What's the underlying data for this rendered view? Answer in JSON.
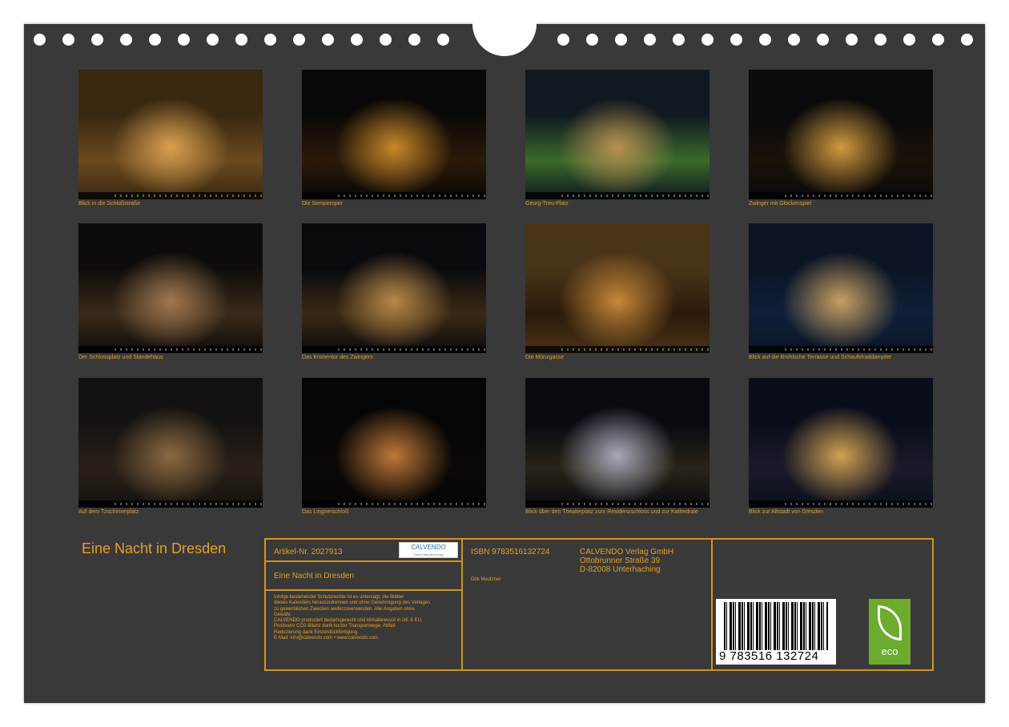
{
  "photos": [
    {
      "caption": "Blick in die Schloßstraße",
      "colors": [
        "#3a2810",
        "#d9a050",
        "#6a4a20"
      ]
    },
    {
      "caption": "Die Semperoper",
      "colors": [
        "#0a0806",
        "#c8882a",
        "#2a1a08"
      ]
    },
    {
      "caption": "Georg-Treu-Platz",
      "colors": [
        "#101820",
        "#b89050",
        "#3a6a2a"
      ]
    },
    {
      "caption": "Zwinger mit Glockenspiel",
      "colors": [
        "#0a0a0a",
        "#d09a40",
        "#1a1208"
      ]
    },
    {
      "caption": "Der Schlossplatz und Ständehaus",
      "colors": [
        "#0e0c0a",
        "#a07850",
        "#3a2a1a"
      ]
    },
    {
      "caption": "Das Kronentor des Zwingers",
      "colors": [
        "#0a0a0e",
        "#b88848",
        "#3a2a14"
      ]
    },
    {
      "caption": "Die Münzgasse",
      "colors": [
        "#4a3418",
        "#c88838",
        "#2a1a0a"
      ]
    },
    {
      "caption": "Blick auf die Brühlsche Terrasse und Schaufelraddampfer",
      "colors": [
        "#0a1424",
        "#c8a060",
        "#10203a"
      ]
    },
    {
      "caption": "Auf dem Tzschirnerplatz",
      "colors": [
        "#141210",
        "#8a6a40",
        "#2a2018"
      ]
    },
    {
      "caption": "Das Lingnerschloß",
      "colors": [
        "#050505",
        "#c07838",
        "#0a0806"
      ]
    },
    {
      "caption": "Blick über den Theaterplatz zum Residenzschloss und zur Kathedrale",
      "colors": [
        "#080a10",
        "#a8a8b8",
        "#2a2418"
      ]
    },
    {
      "caption": "Blick zur Altstadt von Dresden",
      "colors": [
        "#0a0e1a",
        "#d0a050",
        "#1a1a2a"
      ]
    }
  ],
  "title": "Eine Nacht in Dresden",
  "info": {
    "article": "Artikel-Nr. 2027913",
    "logo_text": "CALVENDO",
    "logo_sub": "Dein Kalenderverlag",
    "calendar_title": "Eine Nacht in Dresden",
    "legal_lines": [
      "Infolge bestehender Schutzrechte ist es untersagt, die Blätter",
      "dieses Kalenders herauszutrennen und ohne Genehmigung des Verlages",
      "zu gewerblichen Zwecken weiterzuverwenden. Alle Angaben ohne",
      "Gewähr.",
      "CALVENDO produziert bedarfsgerecht und klimabewusst in DE & EU.",
      "Positivere CO2-Bilanz dank kurzer Transportwege. Abfall-",
      "Reduzierung dank Einzelstückfertigung.",
      "E-Mail: info@calvendo.com • www.calvendo.com"
    ],
    "isbn": "ISBN 9783516132724",
    "author": "Dirk Meutzner",
    "publisher": [
      "CALVENDO Verlag GmbH",
      "Ottobrunner Straße 39",
      "D-82008 Unterhaching"
    ],
    "barcode_number": "9 783516 132724",
    "eco_label": "eco"
  }
}
